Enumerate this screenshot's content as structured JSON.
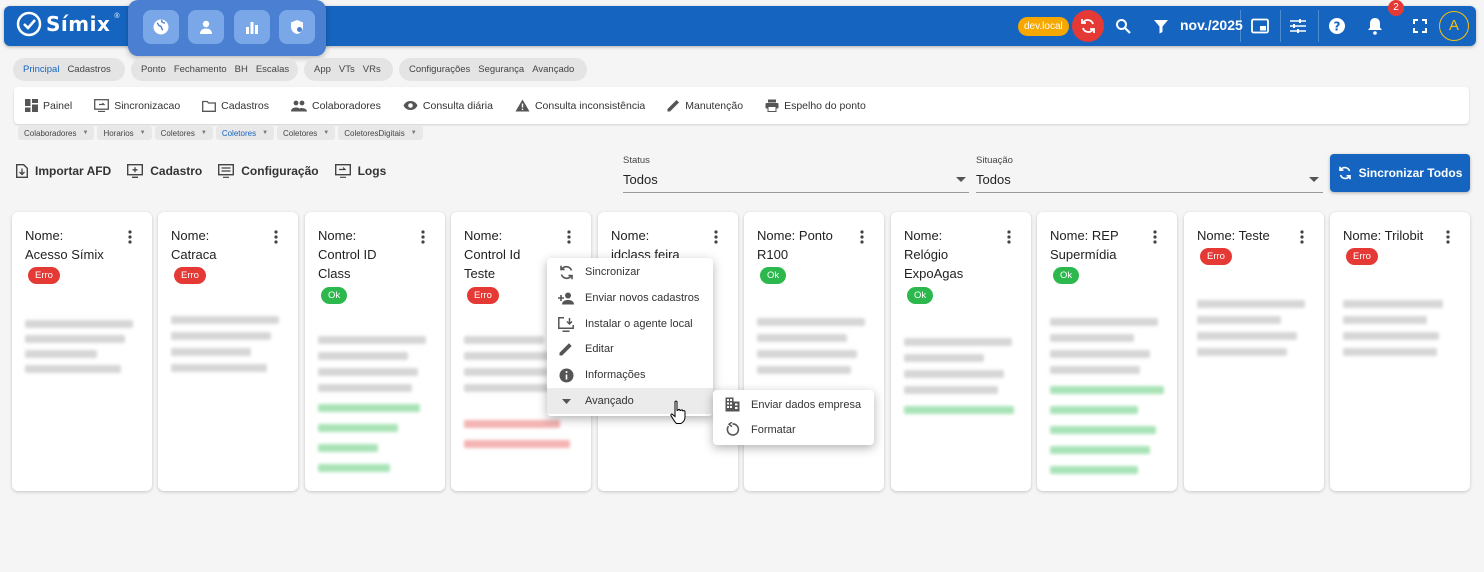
{
  "app": {
    "name": "Símix",
    "env_badge": "dev.local",
    "period": "nov./2025",
    "notifications": "2",
    "avatar_initial": "A"
  },
  "colors": {
    "primary": "#1565c0",
    "error": "#e53935",
    "ok": "#2db84d",
    "env": "#f6a700"
  },
  "nav_groups": [
    {
      "items": [
        "Principal",
        "Cadastros"
      ],
      "active": "Principal"
    },
    {
      "items": [
        "Ponto",
        "Fechamento",
        "BH",
        "Escalas"
      ]
    },
    {
      "items": [
        "App",
        "VTs",
        "VRs"
      ]
    },
    {
      "items": [
        "Configurações",
        "Segurança",
        "Avançado"
      ]
    }
  ],
  "subnav": [
    {
      "label": "Painel",
      "icon": "dashboard-icon"
    },
    {
      "label": "Sincronizacao",
      "icon": "sync-screen-icon"
    },
    {
      "label": "Cadastros",
      "icon": "folder-icon"
    },
    {
      "label": "Colaboradores",
      "icon": "people-icon"
    },
    {
      "label": "Consulta diária",
      "icon": "eye-icon"
    },
    {
      "label": "Consulta inconsistência",
      "icon": "warning-icon"
    },
    {
      "label": "Manutenção",
      "icon": "pencil-icon"
    },
    {
      "label": "Espelho do ponto",
      "icon": "print-icon"
    }
  ],
  "chips": [
    {
      "label": "Colaboradores"
    },
    {
      "label": "Horarios"
    },
    {
      "label": "Coletores"
    },
    {
      "label": "Coletores",
      "active": true
    },
    {
      "label": "Coletores"
    },
    {
      "label": "ColetoresDigitais"
    }
  ],
  "actions": [
    "Importar AFD",
    "Cadastro",
    "Configuração",
    "Logs"
  ],
  "filters": {
    "status": {
      "label": "Status",
      "value": "Todos"
    },
    "situacao": {
      "label": "Situação",
      "value": "Todos"
    }
  },
  "sync_all": "Sincronizar Todos",
  "cards": [
    {
      "name_lines": [
        "Nome:",
        "Acesso Símix"
      ],
      "status": "Erro"
    },
    {
      "name_lines": [
        "Nome:",
        "Catraca"
      ],
      "status": "Erro"
    },
    {
      "name_lines": [
        "Nome:",
        "Control ID",
        "Class"
      ],
      "status": "Ok"
    },
    {
      "name_lines": [
        "Nome:",
        "Control Id",
        "Teste"
      ],
      "status": "Erro"
    },
    {
      "name_lines": [
        "Nome:",
        "idclass feira"
      ],
      "status": ""
    },
    {
      "name_lines": [
        "Nome: Ponto",
        "R100"
      ],
      "status": "Ok"
    },
    {
      "name_lines": [
        "Nome:",
        "Relógio",
        "ExpoAgas"
      ],
      "status": "Ok"
    },
    {
      "name_lines": [
        "Nome: REP",
        "Supermídia"
      ],
      "status": "Ok"
    },
    {
      "name_lines": [
        "Nome: Teste"
      ],
      "status": "Erro"
    },
    {
      "name_lines": [
        "Nome: Trilobit"
      ],
      "status": "Erro"
    }
  ],
  "context_menu": [
    {
      "label": "Sincronizar",
      "icon": "sync-icon"
    },
    {
      "label": "Enviar novos cadastros",
      "icon": "person-add-icon"
    },
    {
      "label": "Instalar o agente local",
      "icon": "install-icon"
    },
    {
      "label": "Editar",
      "icon": "edit-icon"
    },
    {
      "label": "Informações",
      "icon": "info-icon"
    },
    {
      "label": "Avançado",
      "icon": "caret-down-icon"
    }
  ],
  "submenu": [
    {
      "label": "Enviar dados empresa",
      "icon": "building-icon"
    },
    {
      "label": "Formatar",
      "icon": "restore-icon"
    }
  ]
}
